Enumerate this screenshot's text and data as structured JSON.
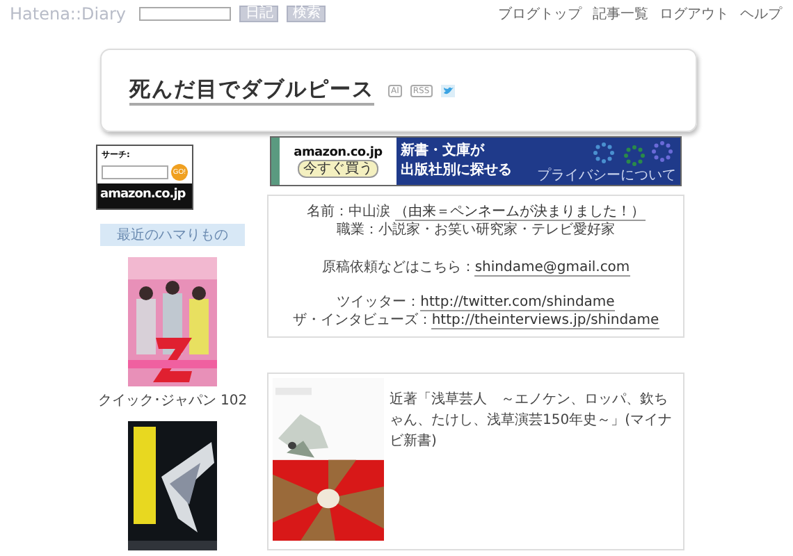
{
  "header": {
    "logo": "Hatena::Diary",
    "buttons": [
      "日記",
      "検索"
    ],
    "links": [
      "ブログトップ",
      "記事一覧",
      "ログアウト",
      "ヘルプ"
    ]
  },
  "blog": {
    "title": "死んだ目でダブルピース",
    "badges": [
      {
        "kind": "text",
        "label": "AI"
      },
      {
        "kind": "text",
        "label": "RSS"
      },
      {
        "kind": "twitter"
      }
    ]
  },
  "amazon_search": {
    "label": "サーチ:",
    "button": "GO!",
    "logo": "amazon.co.jp"
  },
  "sidebar": {
    "heading": "最近のハマりもの",
    "items": [
      {
        "kind": "picture",
        "caption": "クイック･ジャパン 102"
      },
      {
        "kind": "picture"
      }
    ]
  },
  "banner": {
    "logo": "amazon.co.jp",
    "button": "今すぐ買う",
    "lines": [
      "新書・文庫が",
      "出版社別に探せる"
    ],
    "privacy": "プライバシーについて"
  },
  "profile": {
    "groups": [
      [
        {
          "text": "名前：中山涙 ",
          "link": "（由来＝ペンネームが決まりました！）"
        },
        {
          "text": "職業：小説家・お笑い研究家・テレビ愛好家"
        }
      ],
      [
        {
          "text": "原稿依頼などはこちら：",
          "link": "shindame@gmail.com"
        }
      ],
      [
        {
          "text": "ツイッター：",
          "link": "http://twitter.com/shindame"
        },
        {
          "text": "ザ・インタビューズ：",
          "link": "http://theinterviews.jp/shindame"
        }
      ]
    ]
  },
  "book": {
    "kind": "picture",
    "text": "近著「浅草芸人　～エノケン、ロッパ、欽ちゃん、たけし、浅草演芸150年史～」(マイナビ新書)"
  }
}
